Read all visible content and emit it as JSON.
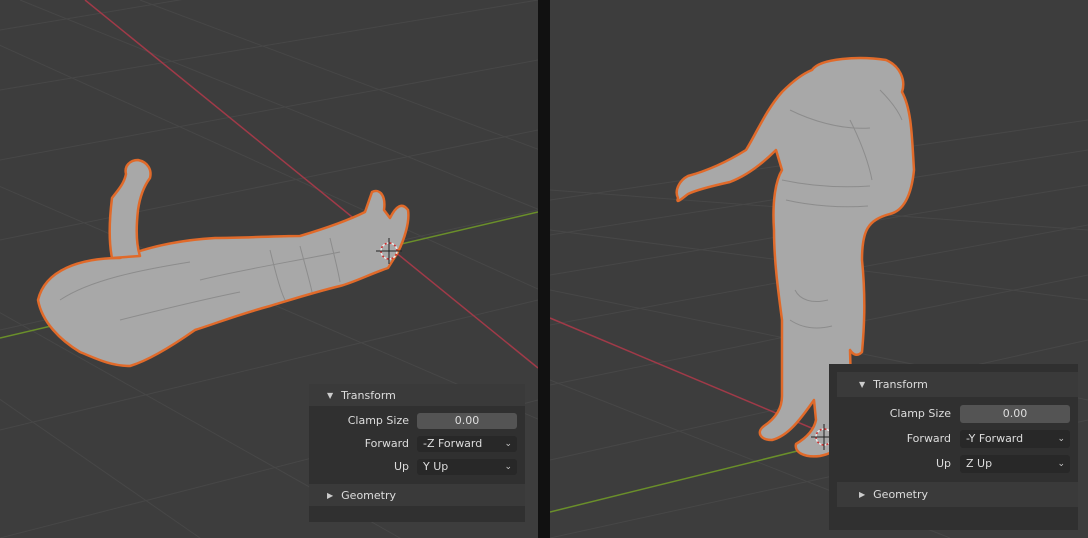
{
  "left_panel": {
    "transform_header": "Transform",
    "clamp_size_label": "Clamp Size",
    "clamp_size_value": "0.00",
    "forward_label": "Forward",
    "forward_value": "-Z Forward",
    "up_label": "Up",
    "up_value": "Y Up",
    "geometry_header": "Geometry"
  },
  "right_panel": {
    "transform_header": "Transform",
    "clamp_size_label": "Clamp Size",
    "clamp_size_value": "0.00",
    "forward_label": "Forward",
    "forward_value": "-Y Forward",
    "up_label": "Up",
    "up_value": "Z Up",
    "geometry_header": "Geometry"
  },
  "icons": {
    "expanded": "▼",
    "collapsed": "▶",
    "dropdown": "chevron-down"
  },
  "colors": {
    "selection_outline": "#e06a2a",
    "x_axis": "#b03a48",
    "y_axis": "#6a8f2a",
    "mesh": "#a8a8a8",
    "viewport_bg": "#3d3d3d"
  }
}
